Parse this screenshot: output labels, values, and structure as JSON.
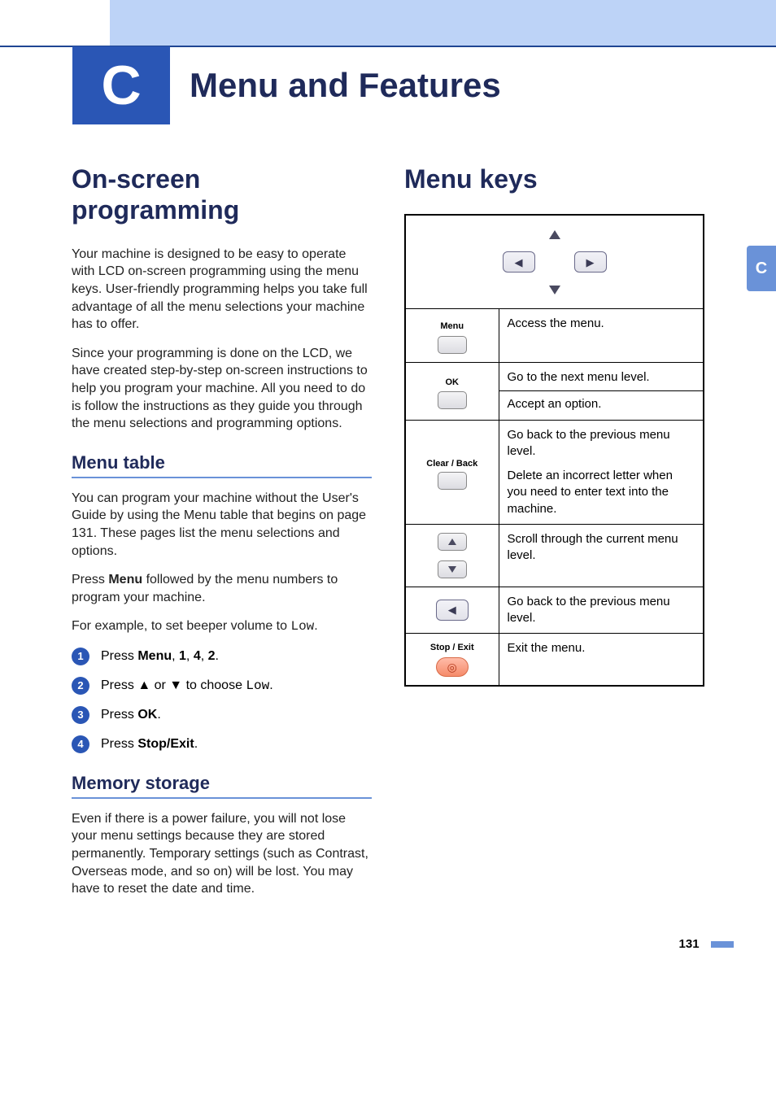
{
  "appendix_letter": "C",
  "title": "Menu and Features",
  "left": {
    "heading": "On-screen programming",
    "para1": "Your machine is designed to be easy to operate with LCD on-screen programming using the menu keys. User-friendly programming helps you take full advantage of all the menu selections your machine has to offer.",
    "para2": "Since your programming is done on the LCD, we have created step-by-step on-screen instructions to help you program your machine. All you need to do is follow the instructions as they guide you through the menu selections and programming options.",
    "menu_table": {
      "heading": "Menu table",
      "para1": "You can program your machine without the User's Guide by using the Menu table that begins on page 131. These pages list the menu selections and options.",
      "para2_prefix": "Press ",
      "para2_bold": "Menu",
      "para2_suffix": " followed by the menu numbers to program your machine.",
      "para3_prefix": "For example, to set beeper volume to ",
      "para3_mono": "Low",
      "para3_suffix": ".",
      "steps": [
        {
          "num": "1",
          "prefix": "Press ",
          "bold": "Menu",
          "mid": ", ",
          "b2": "1",
          "m2": ", ",
          "b3": "4",
          "m3": ", ",
          "b4": "2",
          "suffix": "."
        },
        {
          "num": "2",
          "prefix": "Press ▲ or ▼ to choose ",
          "mono": "Low",
          "suffix": "."
        },
        {
          "num": "3",
          "prefix": "Press ",
          "bold": "OK",
          "suffix": "."
        },
        {
          "num": "4",
          "prefix": "Press ",
          "bold": "Stop/Exit",
          "suffix": "."
        }
      ]
    },
    "memory": {
      "heading": "Memory storage",
      "para": "Even if there is a power failure, you will not lose your menu settings because they are stored permanently. Temporary settings (such as Contrast, Overseas mode, and so on) will be lost. You may have to reset the date and time."
    }
  },
  "right": {
    "heading": "Menu keys",
    "rows": [
      {
        "key_label": "Menu",
        "desc": "Access the menu."
      },
      {
        "key_label": "OK",
        "desc_line1": "Go to the next menu level.",
        "desc_line2": "Accept an option."
      },
      {
        "key_label": "Clear / Back",
        "desc_line1": "Go back to the previous menu level.",
        "desc_line2": "Delete an incorrect letter when you need to enter text into the machine."
      },
      {
        "key_label": "up-down",
        "desc": "Scroll through the current menu level."
      },
      {
        "key_label": "left",
        "desc": "Go back to the previous menu level."
      },
      {
        "key_label": "Stop / Exit",
        "desc": "Exit the menu."
      }
    ]
  },
  "page_number": "131",
  "thumb_tab": "C",
  "arrows": {
    "left": "◀",
    "right": "▶"
  }
}
